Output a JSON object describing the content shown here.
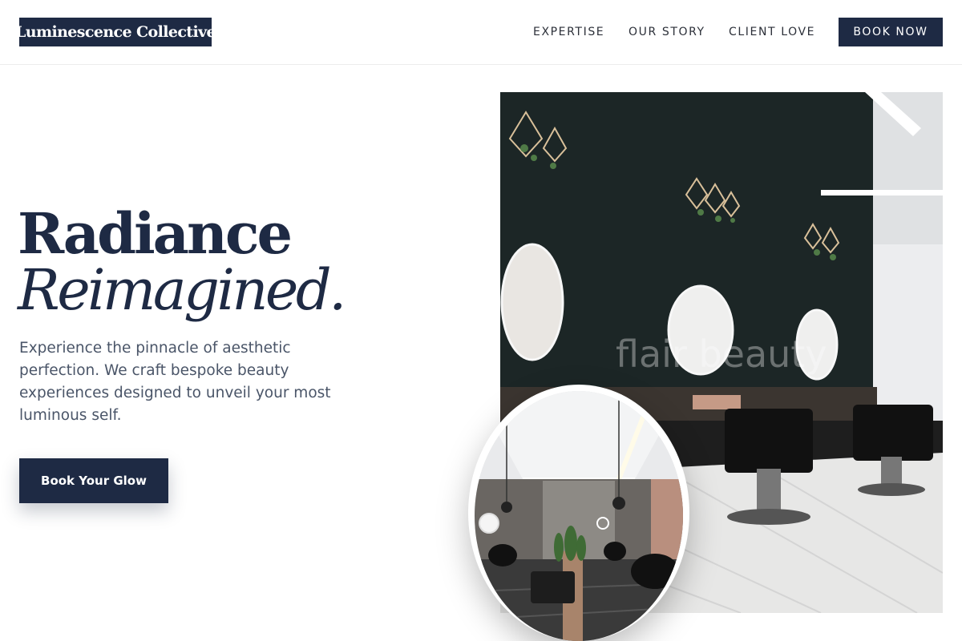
{
  "header": {
    "logo": "Luminescence Collective",
    "nav": [
      "EXPERTISE",
      "OUR STORY",
      "CLIENT LOVE"
    ],
    "book_now": "BOOK NOW"
  },
  "hero": {
    "title_line1": "Radiance",
    "title_line2": "Reimagined.",
    "description": "Experience the pinnacle of aesthetic perfection. We craft bespoke beauty experiences designed to unveil your most luminous self.",
    "cta": "Book Your Glow"
  },
  "images": {
    "salon_photo_watermark": "flair beauty"
  },
  "colors": {
    "brand": "#1e2a44",
    "text_muted": "#4a5568"
  }
}
